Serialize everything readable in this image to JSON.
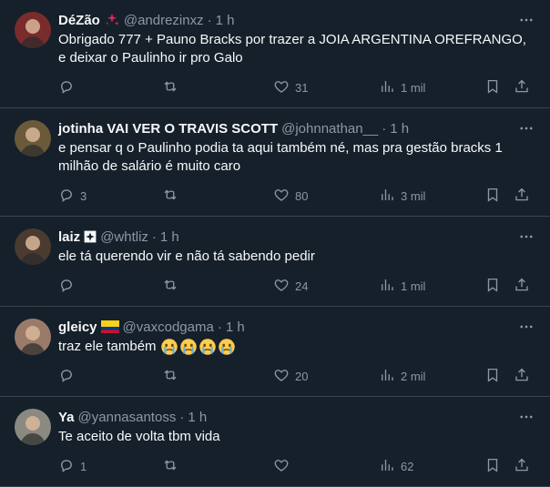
{
  "tweets": [
    {
      "name": "DéZão",
      "badge": "sparkle-badge",
      "handle": "@andrezinxz",
      "time": "1 h",
      "text": "Obrigado 777 + Pauno Bracks por trazer a JOIA ARGENTINA OREFRANGO, e deixar o Paulinho ir pro Galo",
      "replies": "",
      "retweets": "",
      "likes": "31",
      "views": "1 mil",
      "avatar_color": "#7a2b2b"
    },
    {
      "name": "jotinha VAI VER O TRAVIS SCOTT",
      "badge": "",
      "handle": "@johnnathan__",
      "time": "1 h",
      "text": "e pensar q o Paulinho podia ta aqui também né, mas pra gestão bracks 1 milhão de salário é muito caro",
      "replies": "3",
      "retweets": "",
      "likes": "80",
      "views": "3 mil",
      "avatar_color": "#6b5a3a"
    },
    {
      "name": "laiz",
      "badge": "maltese-cross-badge",
      "handle": "@whtliz",
      "time": "1 h",
      "text": "ele tá querendo vir e não tá sabendo pedir",
      "replies": "",
      "retweets": "",
      "likes": "24",
      "views": "1 mil",
      "avatar_color": "#4a3a30"
    },
    {
      "name": "gleicy",
      "badge": "colombia-flag-badge",
      "handle": "@vaxcodgama",
      "time": "1 h",
      "text": "traz ele também",
      "emoji_count": 4,
      "replies": "",
      "retweets": "",
      "likes": "20",
      "views": "2 mil",
      "avatar_color": "#9a7b6a"
    },
    {
      "name": "Ya",
      "badge": "",
      "handle": "@yannasantoss",
      "time": "1 h",
      "text": "Te aceito de volta tbm vida",
      "replies": "1",
      "retweets": "",
      "likes": "",
      "views": "62",
      "avatar_color": "#8a8a80"
    }
  ],
  "colors": {
    "background": "#15202b",
    "text": "#f7f9f9",
    "muted": "#8b98a5",
    "divider": "#38444d"
  },
  "dot": "·"
}
